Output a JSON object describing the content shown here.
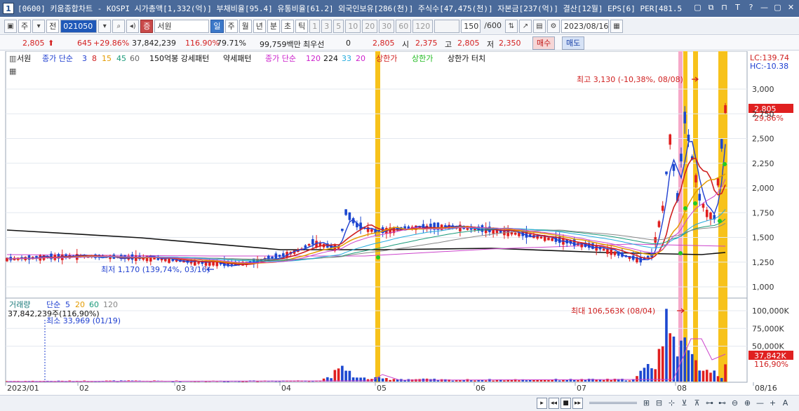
{
  "window": {
    "number": "1",
    "title": "[0600] 키움종합차트 - KOSPI 시가총액[1,332(억)] 부채비율[95.4] 유통비율[61.2] 외국인보유[286(천)] 주식수[47,475(천)] 자본금[237(억)] 결산[12월] EPS[6] PER[481.5",
    "controls": [
      "▢",
      "⧉",
      "⊓",
      "T",
      "?",
      "—",
      "▢",
      "✕"
    ]
  },
  "toolbar": {
    "type_label": "주",
    "prev_label": "전",
    "code": "021050",
    "badge": "증",
    "name": "서원",
    "periods": [
      "일",
      "주",
      "월",
      "년",
      "분",
      "초",
      "틱"
    ],
    "active_period": "일",
    "intervals": [
      "1",
      "3",
      "5",
      "10",
      "20",
      "30",
      "60",
      "120"
    ],
    "count": "150",
    "count_total": "/600",
    "date": "2023/08/16"
  },
  "pricebar": {
    "price": "2,805",
    "change": "645",
    "change_pct": "+29.86%",
    "volume": "37,842,239",
    "volume_ratio": "116.90%",
    "turnover": "79.71%",
    "amount": "99,759백만",
    "prior_label": "최우선",
    "prior_value": "0",
    "last": "2,805",
    "open_label": "시",
    "open": "2,375",
    "high_label": "고",
    "high": "2,805",
    "low_label": "저",
    "low": "2,350",
    "buy_label": "매수",
    "sell_label": "매도"
  },
  "chart_legend": {
    "stock": "서원",
    "ma_label": "종가 단순",
    "ma_periods": [
      "3",
      "8",
      "15",
      "45",
      "60"
    ],
    "extra": [
      "150억봉 강세패턴",
      "약세패턴"
    ],
    "ma2_label": "종가 단순",
    "ma2_periods": [
      "120",
      "224",
      "33",
      "20"
    ],
    "signals": [
      "상한가",
      "상한가",
      "상한가 터치"
    ],
    "lc": "LC:139.74",
    "hc": "HC:-10.38"
  },
  "annotations": {
    "high": "최고 3,130 (-10,38%, 08/08)",
    "low": "최저 1,170 (139,74%, 03/16)",
    "vol_max": "최대 106,563K (08/04)",
    "vol_min": "최소 33,969 (01/19)",
    "current_price": "2,805",
    "current_pct": "29,86%",
    "current_vol": "37,842K",
    "current_vol_pct": "116,90%"
  },
  "volume_legend": {
    "label": "거래량",
    "ma_label": "단순",
    "periods": [
      "5",
      "20",
      "60",
      "120"
    ],
    "value": "37,842,239주(116,90%)"
  },
  "chart_data": {
    "type": "candlestick",
    "price_axis": {
      "ticks": [
        1000,
        1250,
        1500,
        1750,
        2000,
        2250,
        2500,
        2750,
        3000
      ],
      "labels": [
        "1,000",
        "1,250",
        "1,500",
        "1,750",
        "2,000",
        "2,250",
        "2,500",
        "2,750",
        "3,000"
      ]
    },
    "volume_axis": {
      "ticks": [
        50000,
        75000,
        100000
      ],
      "labels": [
        "50,000K",
        "75,000K",
        "100,000K"
      ]
    },
    "x_labels": [
      "2023/01",
      "02",
      "03",
      "04",
      "05",
      "06",
      "07",
      "08",
      "08/16"
    ],
    "price_path": [
      [
        0,
        1280
      ],
      [
        10,
        1300
      ],
      [
        20,
        1310
      ],
      [
        30,
        1300
      ],
      [
        40,
        1290
      ],
      [
        50,
        1250
      ],
      [
        60,
        1230
      ],
      [
        65,
        1240
      ],
      [
        70,
        1280
      ],
      [
        75,
        1320
      ],
      [
        80,
        1380
      ],
      [
        83,
        1450
      ],
      [
        86,
        1420
      ],
      [
        89,
        1400
      ],
      [
        90,
        1400
      ],
      [
        92,
        1750
      ],
      [
        95,
        1620
      ],
      [
        100,
        1560
      ],
      [
        110,
        1600
      ],
      [
        120,
        1610
      ],
      [
        130,
        1580
      ],
      [
        140,
        1530
      ],
      [
        150,
        1470
      ],
      [
        160,
        1400
      ],
      [
        168,
        1310
      ],
      [
        172,
        1270
      ],
      [
        175,
        1320
      ],
      [
        178,
        1800
      ],
      [
        180,
        2500
      ],
      [
        182,
        1900
      ],
      [
        184,
        2700
      ],
      [
        186,
        2300
      ],
      [
        188,
        1900
      ],
      [
        190,
        1750
      ],
      [
        192,
        1700
      ],
      [
        195,
        2805
      ]
    ],
    "volume_path": [
      [
        0,
        800
      ],
      [
        30,
        1200
      ],
      [
        60,
        900
      ],
      [
        85,
        1500
      ],
      [
        92,
        20000
      ],
      [
        95,
        5000
      ],
      [
        120,
        2500
      ],
      [
        170,
        3000
      ],
      [
        176,
        30000
      ],
      [
        178,
        60000
      ],
      [
        180,
        106563
      ],
      [
        182,
        70000
      ],
      [
        184,
        45000
      ],
      [
        186,
        30000
      ],
      [
        188,
        25000
      ],
      [
        190,
        20000
      ],
      [
        192,
        15000
      ],
      [
        194,
        8000
      ],
      [
        195,
        37842
      ]
    ]
  },
  "status": {
    "nav": [
      "▸",
      "◂◂",
      "■",
      "▸▸"
    ],
    "icons": [
      "⊞",
      "⊟",
      "⊹",
      "⊻",
      "⊼",
      "⊶",
      "⊷",
      "⊖",
      "⊕",
      "—",
      "+",
      "A"
    ]
  }
}
